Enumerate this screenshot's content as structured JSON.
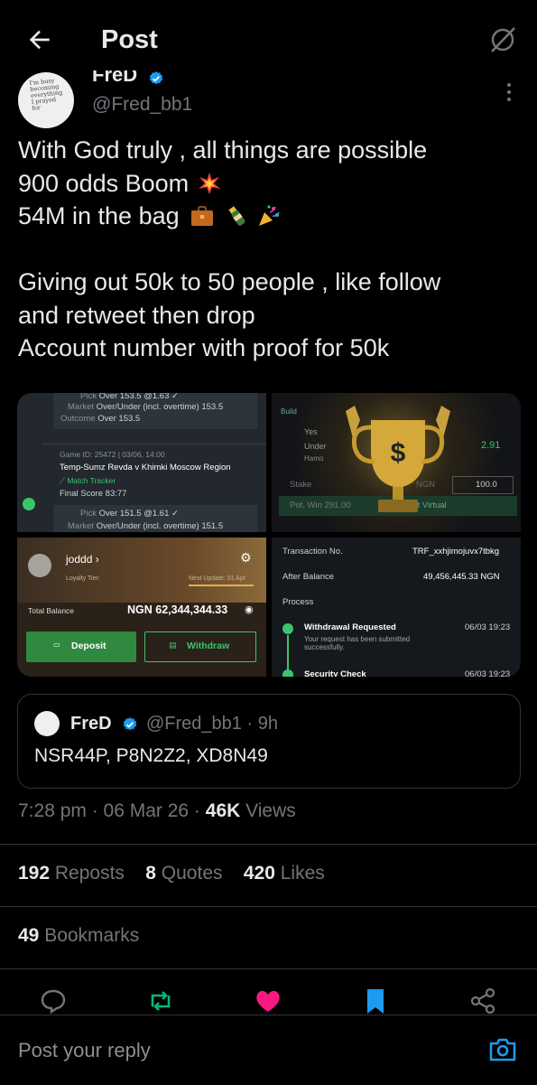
{
  "header": {
    "title": "Post",
    "back_icon": "arrow-left-icon",
    "grok_icon": "grok-icon"
  },
  "author": {
    "name": "FreD",
    "handle": "@Fred_bb1",
    "avatar_text": "I'm busy becoming everything I prayed for"
  },
  "post": {
    "lines": [
      "With God truly , all things are possible",
      "900 odds Boom",
      "54M in the bag",
      "",
      "Giving out 50k to 50 people , like follow",
      "and retweet then drop",
      "Account number with proof for 50k"
    ]
  },
  "media": {
    "bet_slip": {
      "pick1": "Over 153.5 @1.63 ✓",
      "market1": "Over/Under (incl. overtime) 153.5",
      "outcome1": "Over 153.5",
      "game_id": "Game ID: 25472 | 03/06, 14:00",
      "match": "Temp-Sumz Revda v Khimki Moscow Region",
      "tracker": "Match Tracker",
      "final_score": "Final Score  83:77",
      "pick2": "Over 151.5 @1.61 ✓",
      "market2": "Over/Under (incl. overtime) 151.5",
      "label_pick": "Pick",
      "label_market": "Market",
      "label_outcome": "Outcome"
    },
    "trophy": {
      "odds": "2.91",
      "stake_label": "Stake",
      "stake_value": "100.0",
      "win_label": "Pot. Win",
      "win_value": "291.00",
      "bet_label": "Bet Virtual",
      "currency": "NGN",
      "brand": "Build",
      "side_label": "Yes",
      "under_label": "Under",
      "team": "Hamo"
    },
    "wallet": {
      "username": "joddd",
      "loyalty": "Loyalty Tier:",
      "next_update": "Next Update: 01 Apr",
      "balance_label": "Total Balance",
      "balance": "NGN 62,344,344.33",
      "deposit": "Deposit",
      "withdraw": "Withdraw"
    },
    "transaction": {
      "txn_label": "Transaction No.",
      "txn_value": "TRF_xxhjimojuvx7tbkg",
      "after_label": "After Balance",
      "after_value": "49,456,445.33 NGN",
      "process_label": "Process",
      "step1_title": "Withdrawal Requested",
      "step1_time": "06/03 19:23",
      "step1_desc": "Your request has been submitted successfully.",
      "step2_title": "Security Check",
      "step2_time": "06/03 19:23"
    }
  },
  "quote": {
    "name": "FreD",
    "meta": "@Fred_bb1 · 9h",
    "text": "NSR44P, P8N2Z2, XD8N49"
  },
  "meta": {
    "time": "7:28 pm · 06 Mar 26 · ",
    "views_count": "46K",
    "views_label": " Views"
  },
  "stats": {
    "reposts_count": "192",
    "reposts_label": " Reposts",
    "quotes_count": "8",
    "quotes_label": " Quotes",
    "likes_count": "420",
    "likes_label": " Likes",
    "bookmarks_count": "49",
    "bookmarks_label": " Bookmarks"
  },
  "actions": [
    "reply-icon",
    "repost-icon",
    "like-icon",
    "bookmark-icon",
    "share-icon"
  ],
  "colors": {
    "repost": "#00ba7c",
    "like": "#f91880",
    "bookmark": "#1d9bf0",
    "verified": "#1d9bf0"
  },
  "reply": {
    "placeholder": "Post your reply"
  }
}
